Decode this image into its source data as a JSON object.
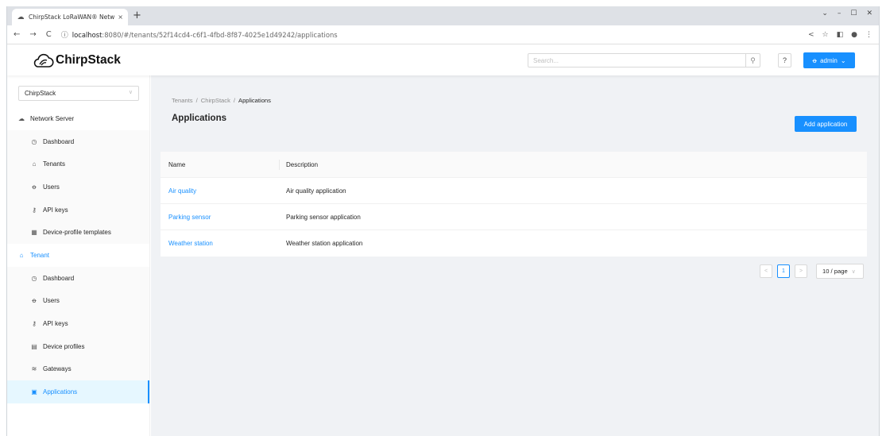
{
  "browser": {
    "tab_title": "ChirpStack LoRaWAN® Netw",
    "tab_close": "×",
    "new_tab": "+",
    "window_controls": [
      "⌄",
      "–",
      "☐",
      "✕"
    ],
    "url_host": "localhost",
    "url_path": ":8080/#/tenants/52f14cd4-c6f1-4fbd-8f87-4025e1d49242/applications",
    "nav": [
      "←",
      "→",
      "C"
    ],
    "addr_icons": [
      "share-icon",
      "star-icon",
      "sidepanel-icon",
      "profile-icon",
      "menu-icon"
    ]
  },
  "header": {
    "logo_text": "ChirpStack",
    "search_placeholder": "Search...",
    "help_label": "?",
    "user_label": "admin"
  },
  "sidebar": {
    "tenant_select": "ChirpStack",
    "items": [
      {
        "label": "Network Server",
        "kind": "group",
        "icon": "cloud-icon"
      },
      {
        "label": "Dashboard",
        "kind": "sub",
        "icon": "dashboard-icon"
      },
      {
        "label": "Tenants",
        "kind": "sub",
        "icon": "home-icon"
      },
      {
        "label": "Users",
        "kind": "sub",
        "icon": "user-icon"
      },
      {
        "label": "API keys",
        "kind": "sub",
        "icon": "key-icon"
      },
      {
        "label": "Device-profile templates",
        "kind": "sub",
        "icon": "template-icon"
      },
      {
        "label": "Tenant",
        "kind": "group-active",
        "icon": "home-icon"
      },
      {
        "label": "Dashboard",
        "kind": "sub",
        "icon": "dashboard-icon"
      },
      {
        "label": "Users",
        "kind": "sub",
        "icon": "user-icon"
      },
      {
        "label": "API keys",
        "kind": "sub",
        "icon": "key-icon"
      },
      {
        "label": "Device profiles",
        "kind": "sub",
        "icon": "profile-icon"
      },
      {
        "label": "Gateways",
        "kind": "sub",
        "icon": "wifi-icon"
      },
      {
        "label": "Applications",
        "kind": "active",
        "icon": "apps-icon"
      }
    ]
  },
  "main": {
    "breadcrumb": [
      "Tenants",
      "ChirpStack",
      "Applications"
    ],
    "breadcrumb_sep": "/",
    "title": "Applications",
    "add_button": "Add application",
    "table": {
      "columns": [
        "Name",
        "Description"
      ],
      "rows": [
        {
          "name": "Air quality",
          "description": "Air quality application"
        },
        {
          "name": "Parking sensor",
          "description": "Parking sensor application"
        },
        {
          "name": "Weather station",
          "description": "Weather station application"
        }
      ]
    },
    "pagination": {
      "prev": "<",
      "current_page": "1",
      "next": ">",
      "page_size": "10 / page"
    }
  },
  "colors": {
    "accent": "#1890ff",
    "content_bg": "#f0f2f5"
  }
}
